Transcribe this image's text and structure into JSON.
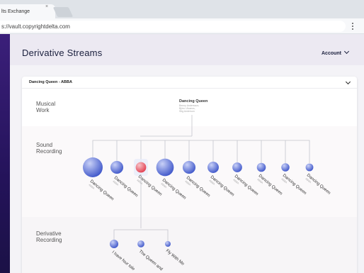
{
  "browser": {
    "tab_title": "lts Exchange",
    "tab_close": "×",
    "url": "s://vault.copyrightdelta.com"
  },
  "app": {
    "title": "Derivative Streams",
    "account_label": "Account"
  },
  "card": {
    "title": "Dancing Queen - ABBA"
  },
  "bands": {
    "musical_work": [
      "Musical",
      "Work"
    ],
    "sound_recording": [
      "Sound",
      "Recording"
    ],
    "derivative_recording": [
      "Derivative",
      "Recording"
    ]
  },
  "musical_work": {
    "title": "Dancing Queen",
    "details": [
      "Benny Andersson,",
      "Björn Ulvaeus,",
      "Stig Anderson"
    ]
  },
  "sound_recordings": [
    {
      "label": "Dancing Queen",
      "sub": "ABBA",
      "size": 1.0,
      "selected": false
    },
    {
      "label": "Dancing Queen",
      "sub": "ABBA",
      "size": 0.55,
      "selected": false
    },
    {
      "label": "Dancing Queen",
      "sub": "ABBA",
      "size": 0.4,
      "selected": true
    },
    {
      "label": "Dancing Queen",
      "sub": "ABBA",
      "size": 0.85,
      "selected": false
    },
    {
      "label": "Dancing Queen",
      "sub": "ABBA",
      "size": 0.55,
      "selected": false
    },
    {
      "label": "Dancing Queen",
      "sub": "ABBA",
      "size": 0.45,
      "selected": false
    },
    {
      "label": "Dancing Queen",
      "sub": "ABBA",
      "size": 0.35,
      "selected": false
    },
    {
      "label": "Dancing Queen",
      "sub": "ABBA",
      "size": 0.3,
      "selected": false
    },
    {
      "label": "Dancing Queen",
      "sub": "ABBA",
      "size": 0.25,
      "selected": false
    },
    {
      "label": "Dancing Queen",
      "sub": "ABBA",
      "size": 0.22,
      "selected": false
    }
  ],
  "derivative_recordings": [
    {
      "label": "I have four tole",
      "sub": "",
      "size": 0.45
    },
    {
      "label": "The Queen and",
      "sub": "",
      "size": 0.32
    },
    {
      "label": "Fly With Me",
      "sub": "",
      "size": 0.22
    }
  ],
  "colors": {
    "node_blue": "#3d55c9",
    "node_light": "#e9ecfa",
    "node_red": "#e23d4f",
    "accent_left": "#2a1766"
  }
}
